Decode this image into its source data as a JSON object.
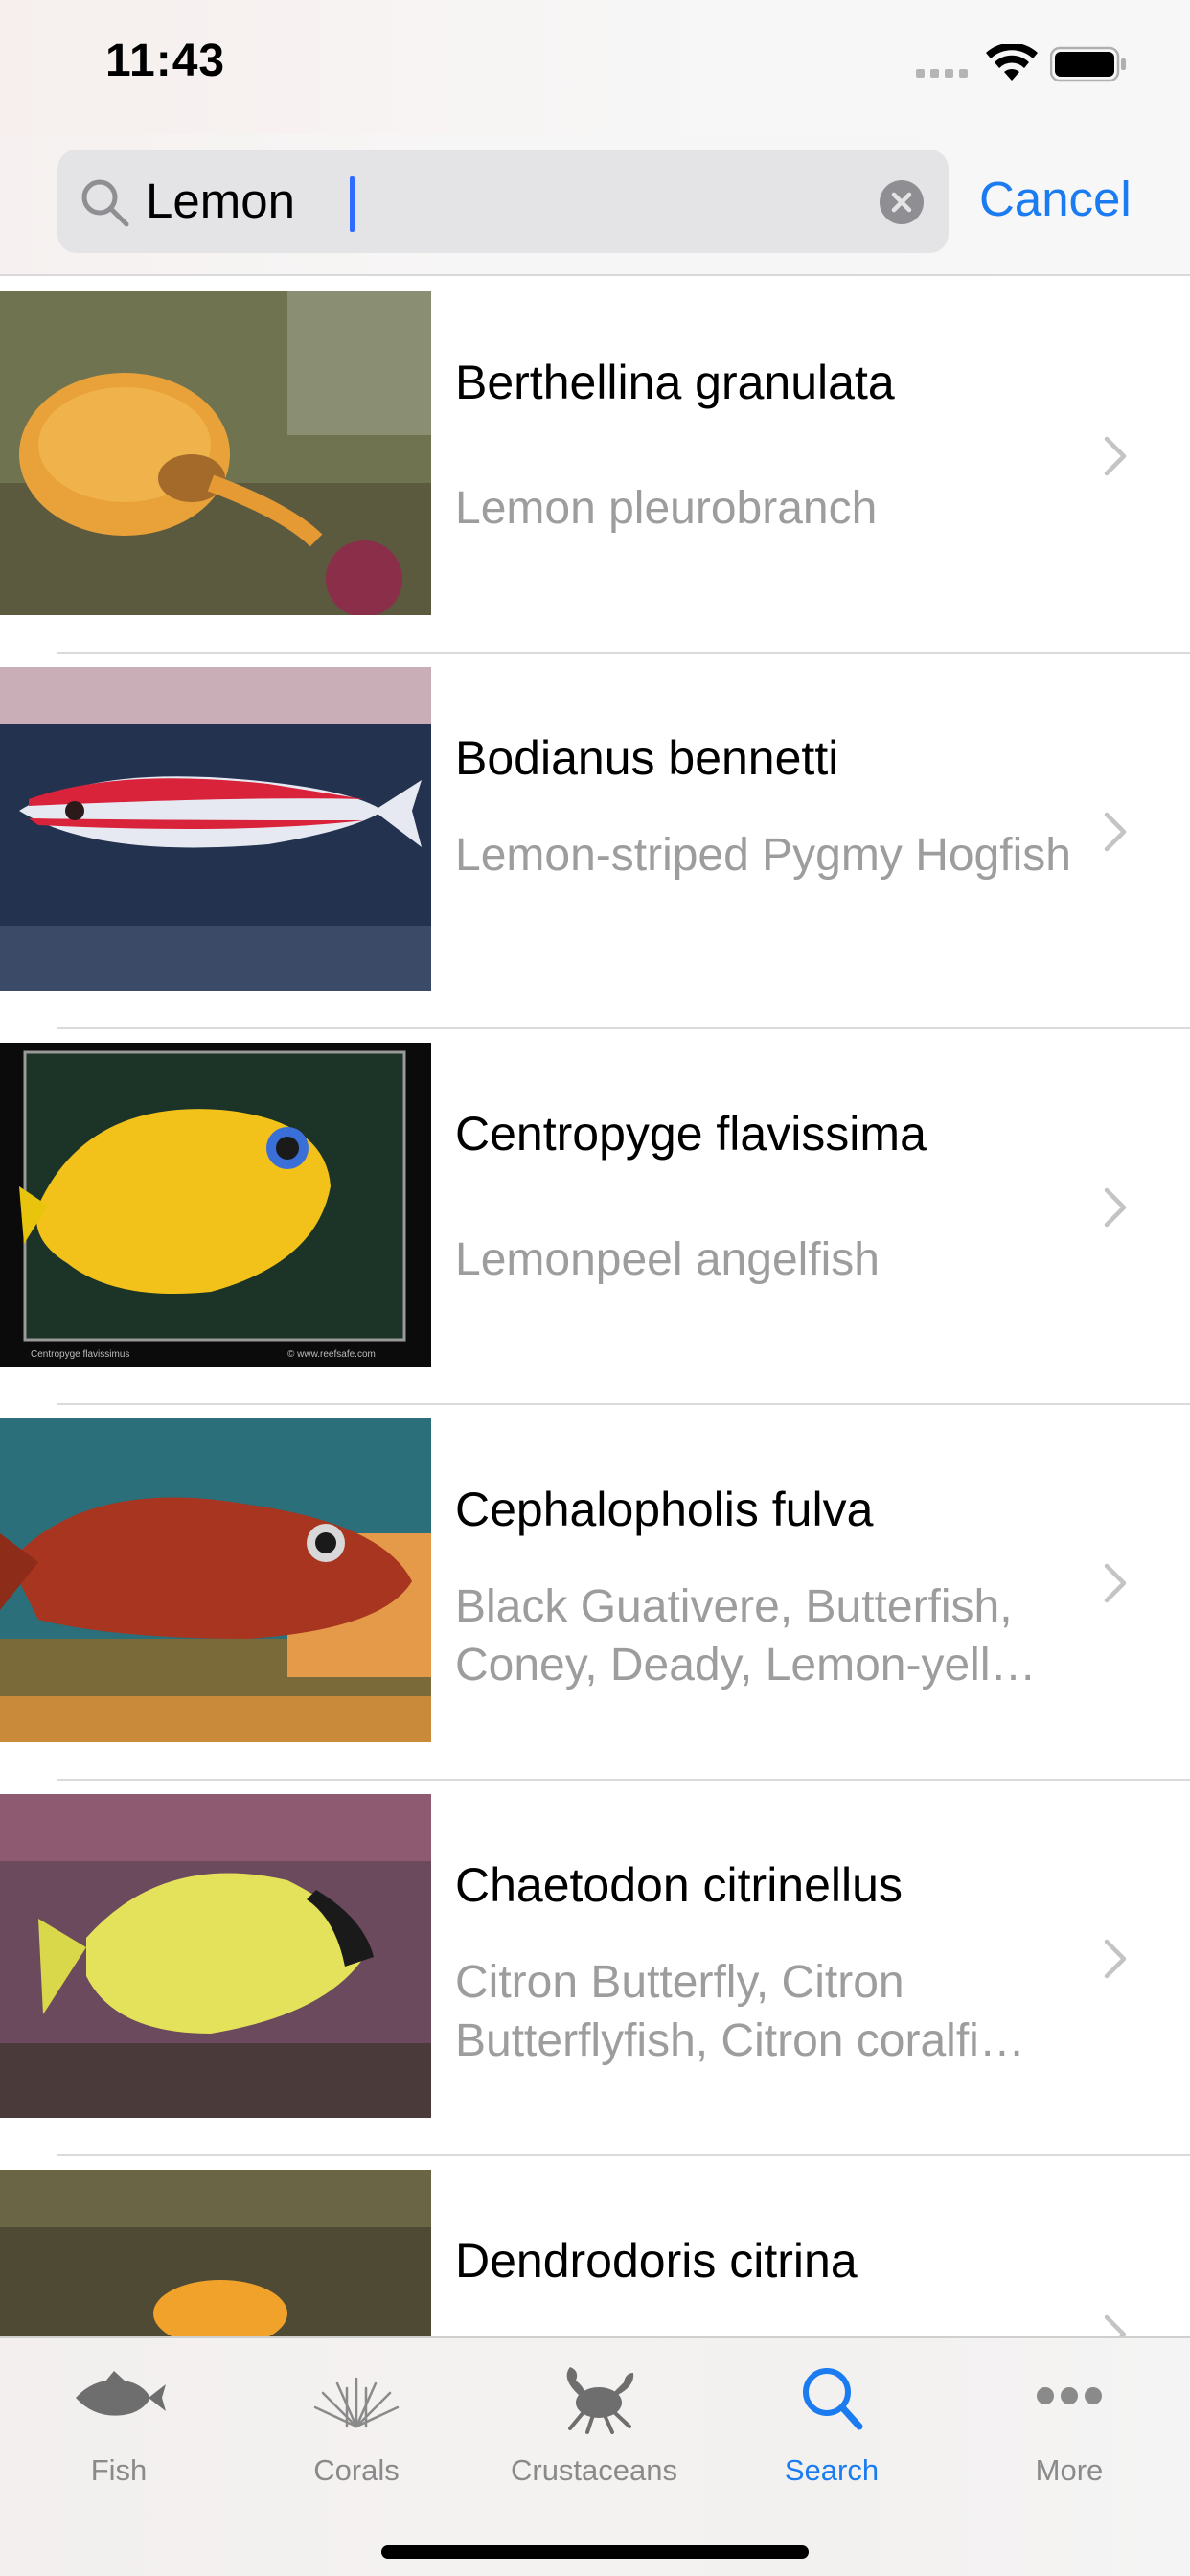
{
  "status_bar": {
    "time": "11:43",
    "icons": [
      "cellular-signal-icon",
      "wifi-icon",
      "battery-icon"
    ]
  },
  "search": {
    "value": "Lemon",
    "cancel_label": "Cancel",
    "icons": [
      "search-icon",
      "clear-icon"
    ]
  },
  "results": [
    {
      "scientific": "Berthellina granulata",
      "common": "Lemon pleurobranch"
    },
    {
      "scientific": "Bodianus bennetti",
      "common": "Lemon-striped Pygmy Hogfish"
    },
    {
      "scientific": "Centropyge flavissima",
      "common": "Lemonpeel angelfish",
      "image_caption_left": "Centropyge flavissimus",
      "image_caption_right": "© www.reefsafe.com"
    },
    {
      "scientific": "Cephalopholis fulva",
      "common": "Black Guativere, Butterfish, Coney, Deady, Lemon-yell…"
    },
    {
      "scientific": "Chaetodon citrinellus",
      "common": "Citron Butterfly, Citron Butterflyfish, Citron coralfi…"
    },
    {
      "scientific": "Dendrodoris citrina",
      "common": ""
    }
  ],
  "tab_bar": {
    "tabs": [
      {
        "label": "Fish",
        "icon": "fish-icon"
      },
      {
        "label": "Corals",
        "icon": "coral-icon"
      },
      {
        "label": "Crustaceans",
        "icon": "crab-icon"
      },
      {
        "label": "Search",
        "icon": "search-icon",
        "active": true
      },
      {
        "label": "More",
        "icon": "more-icon"
      }
    ],
    "active_color": "#1a7cf0",
    "inactive_color": "#8a8a8a"
  }
}
